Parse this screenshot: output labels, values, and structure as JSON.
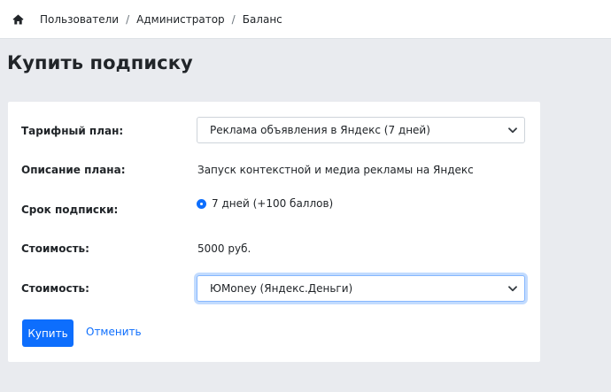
{
  "breadcrumb": {
    "home_icon": "home-icon",
    "items": [
      "Пользователи",
      "Администратор",
      "Баланс"
    ],
    "separator": "/"
  },
  "page": {
    "title": "Купить подписку"
  },
  "form": {
    "tariff": {
      "label": "Тарифный план:",
      "selected": "Реклама объявления в Яндекс (7 дней)"
    },
    "description": {
      "label": "Описание плана:",
      "value": "Запуск контекстной и медиа рекламы на Яндекс"
    },
    "term": {
      "label": "Срок подписки:",
      "option": "7 дней (+100 баллов)",
      "checked": true
    },
    "cost": {
      "label": "Стоимость:",
      "value": "5000 руб."
    },
    "payment": {
      "label": "Стоимость:",
      "selected": "ЮMoney (Яндекс.Деньги)"
    },
    "actions": {
      "buy_label": "Купить",
      "cancel_label": "Отменить"
    }
  },
  "colors": {
    "accent": "#0d6efd",
    "background": "#e9ebef",
    "card": "#ffffff"
  }
}
